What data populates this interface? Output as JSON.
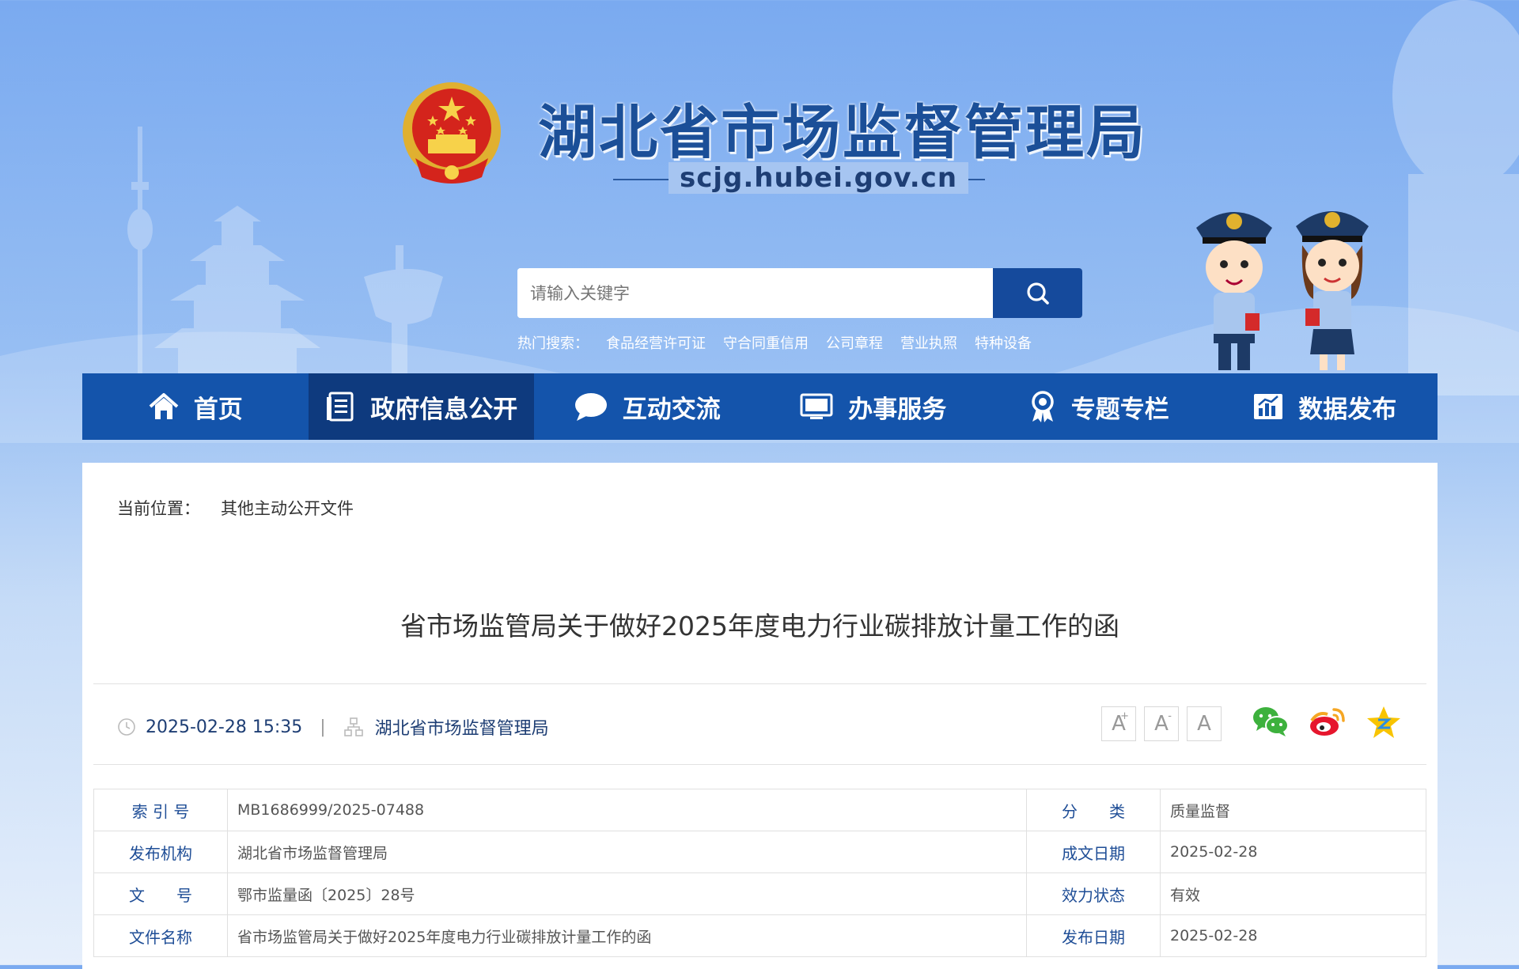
{
  "header": {
    "site_title": "湖北省市场监督管理局",
    "domain": "scjg.hubei.gov.cn",
    "search_placeholder": "请输入关键字",
    "hot_search_label": "热门搜索：",
    "hot_search": [
      "食品经营许可证",
      "守合同重信用",
      "公司章程",
      "营业执照",
      "特种设备"
    ]
  },
  "nav": {
    "items": [
      {
        "label": "首页",
        "icon": "home-icon"
      },
      {
        "label": "政府信息公开",
        "icon": "document-icon"
      },
      {
        "label": "互动交流",
        "icon": "chat-bubble-icon"
      },
      {
        "label": "办事服务",
        "icon": "monitor-icon"
      },
      {
        "label": "专题专栏",
        "icon": "award-icon"
      },
      {
        "label": "数据发布",
        "icon": "bar-chart-icon"
      }
    ],
    "active_index": 1
  },
  "breadcrumb": {
    "label": "当前位置：",
    "current": "其他主动公开文件"
  },
  "article": {
    "title": "省市场监管局关于做好2025年度电力行业碳排放计量工作的函",
    "date": "2025-02-28 15:35",
    "separator": "|",
    "source": "湖北省市场监督管理局"
  },
  "tools": {
    "font_large": "A",
    "font_large_mark": "+",
    "font_small": "A",
    "font_small_mark": "-",
    "font_reset": "A",
    "share": [
      "wechat-icon",
      "weibo-icon",
      "qzone-icon"
    ]
  },
  "meta_table": [
    {
      "label1": "索 引 号",
      "value1": "MB1686999/2025-07488",
      "label2": "分　　类",
      "value2": "质量监督"
    },
    {
      "label1": "发布机构",
      "value1": "湖北省市场监督管理局",
      "label2": "成文日期",
      "value2": "2025-02-28"
    },
    {
      "label1": "文　　号",
      "value1": "鄂市监量函〔2025〕28号",
      "label2": "效力状态",
      "value2": "有效"
    },
    {
      "label1": "文件名称",
      "value1": "省市场监管局关于做好2025年度电力行业碳排放计量工作的函",
      "label2": "发布日期",
      "value2": "2025-02-28"
    }
  ],
  "colors": {
    "nav_bg": "#1454ab",
    "nav_active": "#0e3a7e",
    "label_blue": "#1e4d96",
    "search_button": "#154a9c"
  }
}
